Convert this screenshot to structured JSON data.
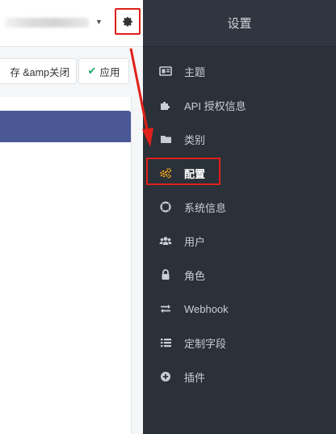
{
  "header": {
    "save_label": "存 &amp关闭",
    "apply_label": "应用"
  },
  "sidebar": {
    "title": "设置",
    "items": [
      {
        "label": "主题",
        "icon": "theme-icon"
      },
      {
        "label": "API 授权信息",
        "icon": "puzzle-icon"
      },
      {
        "label": "类别",
        "icon": "folder-icon"
      },
      {
        "label": "配置",
        "icon": "gears-icon",
        "active": true
      },
      {
        "label": "系统信息",
        "icon": "lifebuoy-icon"
      },
      {
        "label": "用户",
        "icon": "users-icon"
      },
      {
        "label": "角色",
        "icon": "lock-icon"
      },
      {
        "label": "Webhook",
        "icon": "exchange-icon"
      },
      {
        "label": "定制字段",
        "icon": "list-icon"
      },
      {
        "label": "插件",
        "icon": "plus-circle-icon"
      }
    ]
  },
  "colors": {
    "sidebar_bg": "#2b3139",
    "accent_active_icon": "#f0a21b",
    "highlight_red": "#e0201a",
    "panel_header": "#4a5896",
    "check_green": "#22a86b"
  }
}
